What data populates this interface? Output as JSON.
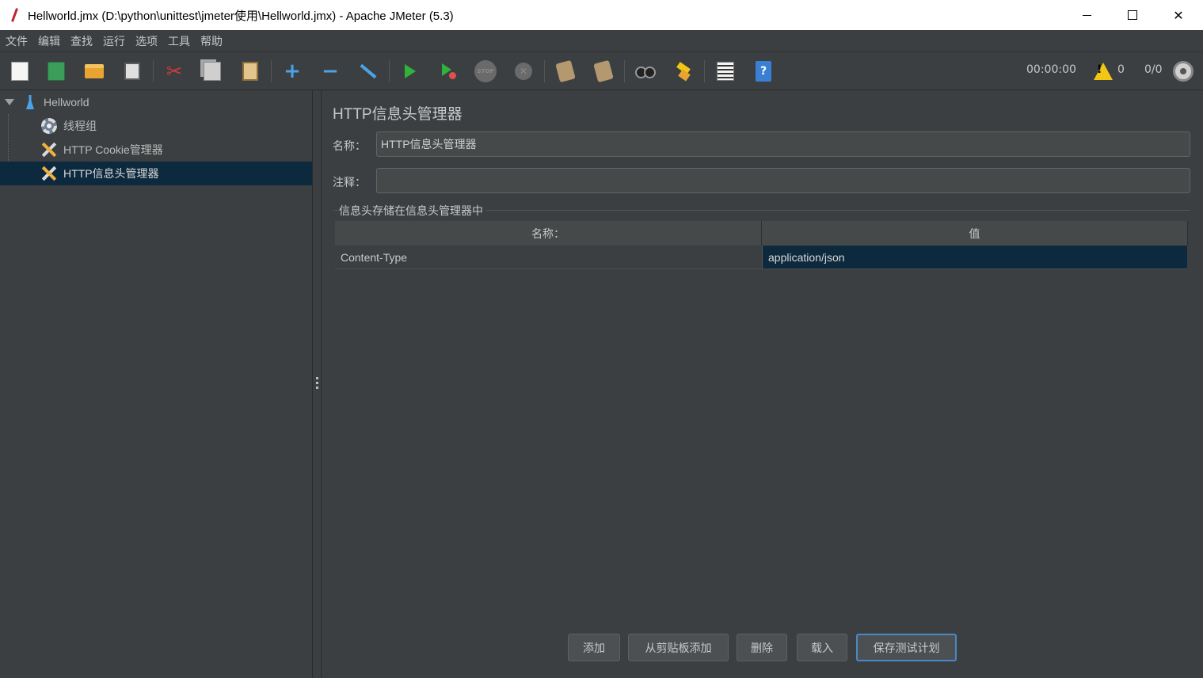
{
  "window": {
    "title": "Hellworld.jmx (D:\\python\\unittest\\jmeter使用\\Hellworld.jmx) - Apache JMeter (5.3)",
    "close_glyph": "✕"
  },
  "menu": [
    "文件",
    "编辑",
    "查找",
    "运行",
    "选项",
    "工具",
    "帮助"
  ],
  "toolbar": {
    "icons": [
      "new-icon",
      "templates-icon",
      "open-icon",
      "save-icon",
      "cut-icon",
      "copy-icon",
      "paste-icon",
      "expand-icon",
      "collapse-icon",
      "toggle-icon",
      "start-icon",
      "start-no-timers-icon",
      "stop-icon",
      "shutdown-icon",
      "clear-icon",
      "clear-all-icon",
      "search-icon",
      "reset-search-icon",
      "function-helper-icon",
      "help-icon"
    ],
    "stop_text": "STOP",
    "elapsed_time": "00:00:00",
    "warning_count": "0",
    "threads": "0/0"
  },
  "tree": {
    "root": "Hellworld",
    "children": [
      "线程组",
      "HTTP Cookie管理器",
      "HTTP信息头管理器"
    ],
    "selected_index": 2
  },
  "panel": {
    "title": "HTTP信息头管理器",
    "name_label": "名称：",
    "name_value": "HTTP信息头管理器",
    "comment_label": "注释：",
    "comment_value": "",
    "group_title": "信息头存储在信息头管理器中",
    "table": {
      "headers": [
        "名称：",
        "值"
      ],
      "rows": [
        {
          "name": "Content-Type",
          "value": "application/json"
        }
      ]
    },
    "buttons": [
      "添加",
      "从剪贴板添加",
      "删除",
      "载入",
      "保存测试计划"
    ]
  },
  "colors": {
    "background": "#3c3f41",
    "selection": "#0d293e",
    "accent": "#4a88c7"
  }
}
